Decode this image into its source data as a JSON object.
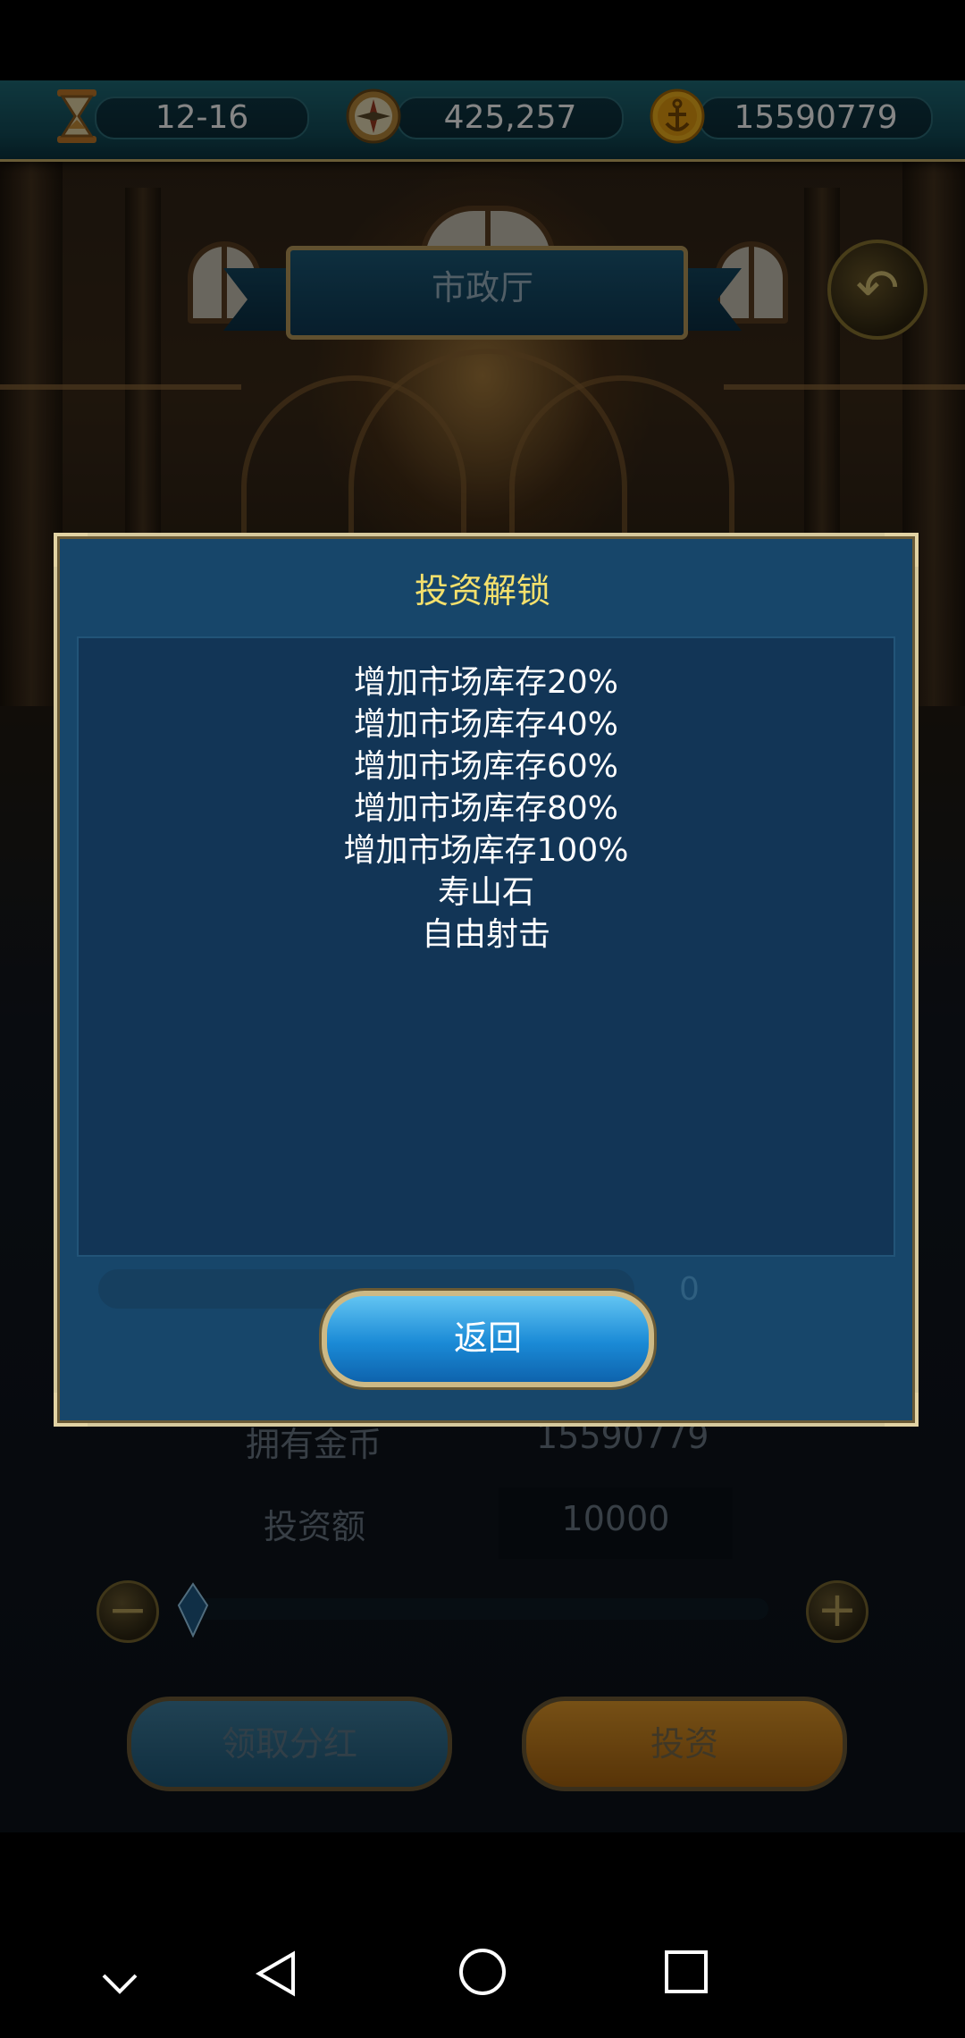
{
  "resources": {
    "date": "12-16",
    "compass_value": "425,257",
    "gold": "15590779"
  },
  "screen_title": "市政厅",
  "dialog": {
    "title": "投资解锁",
    "unlock_items": [
      "增加市场库存20%",
      "增加市场库存40%",
      "增加市场库存60%",
      "增加市场库存80%",
      "增加市场库存100%",
      "寿山石",
      "自由射击"
    ],
    "back_button": "返回"
  },
  "background_panel": {
    "owned_gold_label": "拥有金币",
    "owned_gold_value": "15590779",
    "invest_amount_label": "投资额",
    "invest_amount_value": "10000",
    "slider_value": 0,
    "dividend_button": "领取分红",
    "invest_button": "投资",
    "hidden_zero": "0"
  },
  "icons": {
    "date": "hourglass-icon",
    "compass": "compass-icon",
    "gold": "anchor-coin-icon",
    "back": "return-arrow-icon"
  },
  "colors": {
    "dialog_title": "#f4e06c",
    "dialog_bg": "#17466a",
    "back_button": "#1a8ad6",
    "invest_button": "#d98a1a"
  }
}
